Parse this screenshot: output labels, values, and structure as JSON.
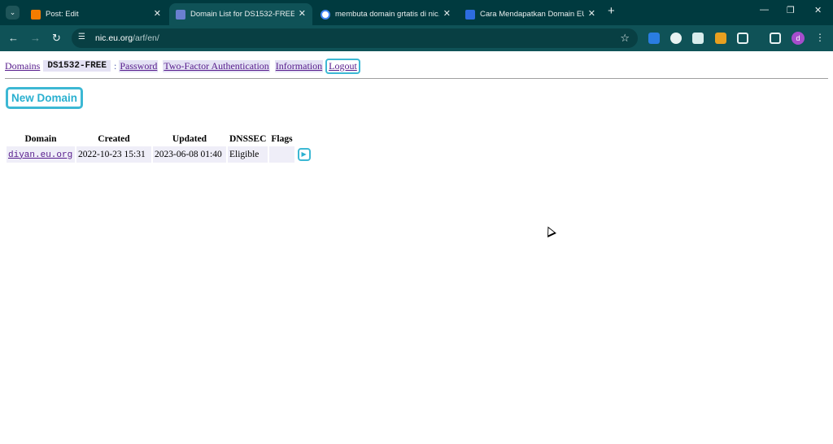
{
  "browser": {
    "tabs": [
      {
        "title": "Post: Edit",
        "favicon": "blogger-icon",
        "color": "#f57c00"
      },
      {
        "title": "Domain List for DS1532-FREE",
        "favicon": "eu-org-icon",
        "color": "#6a7fd0"
      },
      {
        "title": "membuta domain grtatis di nic.",
        "favicon": "google-icon",
        "color": "#ffffff"
      },
      {
        "title": "Cara Mendapatkan Domain EU.",
        "favicon": "page-icon",
        "color": "#2d6cdf"
      }
    ],
    "url_host": "nic.eu.org",
    "url_path": "/arf/en/",
    "avatar_letter": "d",
    "ext_badge": "off"
  },
  "nav": {
    "domains": "Domains",
    "handle": "DS1532-FREE",
    "separator": ":",
    "password": "Password",
    "two_factor": "Two-Factor Authentication",
    "information": "Information",
    "logout": "Logout"
  },
  "new_domain_label": "New Domain",
  "table": {
    "headers": [
      "Domain",
      "Created",
      "Updated",
      "DNSSEC",
      "Flags"
    ],
    "rows": [
      {
        "domain": "diyan.eu.org",
        "created": "2022-10-23 15:31",
        "updated": "2023-06-08 01:40",
        "dnssec": "Eligible",
        "flags": ""
      }
    ]
  },
  "colors": {
    "accent": "#3cb8d4",
    "chrome": "#0f5257",
    "link": "#551a8b"
  }
}
